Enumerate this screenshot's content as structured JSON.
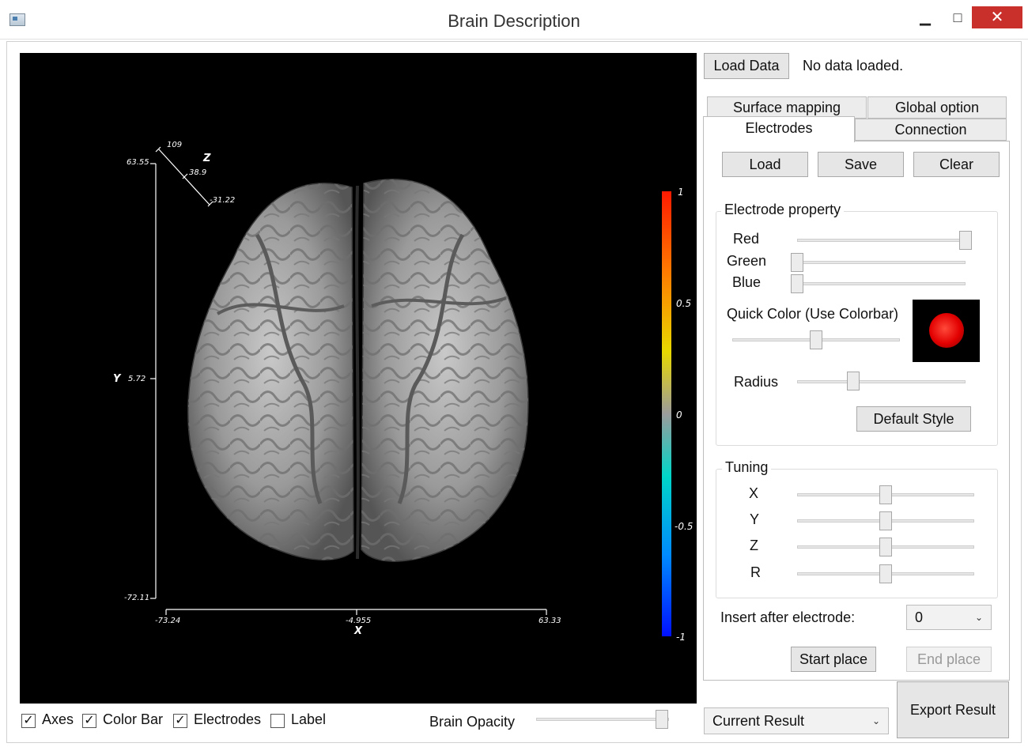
{
  "window": {
    "title": "Brain Description",
    "minimize": "▁",
    "maximize": "□",
    "close": "✕"
  },
  "viewport": {
    "axes": {
      "y_top": "63.55",
      "y_mid": "5.72",
      "y_bottom": "-72.11",
      "y_name": "Y",
      "x_left": "-73.24",
      "x_mid": "-4.955",
      "x_right": "63.33",
      "x_name": "X",
      "z_top": "109",
      "z_mid": "38.9",
      "z_bottom": "-31.22",
      "z_name": "Z"
    },
    "colorbar": {
      "max": "1",
      "upper": "0.5",
      "mid": "0",
      "lower": "-0.5",
      "min": "-1"
    }
  },
  "load_data": {
    "button": "Load Data",
    "status": "No data loaded."
  },
  "tabs": {
    "surface_mapping": "Surface mapping",
    "global_option": "Global option",
    "electrodes": "Electrodes",
    "connection": "Connection",
    "active": "Electrodes"
  },
  "electrodes": {
    "load": "Load",
    "save": "Save",
    "clear": "Clear",
    "property_title": "Electrode property",
    "red_label": "Red",
    "green_label": "Green",
    "blue_label": "Blue",
    "red_value": 1.0,
    "green_value": 0.0,
    "blue_value": 0.0,
    "quick_color_label": "Quick Color (Use Colorbar)",
    "quick_color_value": 0.5,
    "swatch_color": "#e20000",
    "radius_label": "Radius",
    "radius_value": 0.33,
    "default_style": "Default Style",
    "tuning_title": "Tuning",
    "tuning_x": "X",
    "tuning_y": "Y",
    "tuning_z": "Z",
    "tuning_r": "R",
    "tuning_value": 0.5,
    "insert_after_label": "Insert after electrode:",
    "insert_after_value": "0",
    "start_place": "Start place",
    "end_place": "End place"
  },
  "footer": {
    "axes": "Axes",
    "color_bar": "Color Bar",
    "electrodes": "Electrodes",
    "label": "Label",
    "axes_checked": true,
    "color_bar_checked": true,
    "electrodes_checked": true,
    "label_checked": false,
    "brain_opacity": "Brain Opacity",
    "brain_opacity_value": 1.0,
    "result_select": "Current Result",
    "export": "Export Result"
  }
}
